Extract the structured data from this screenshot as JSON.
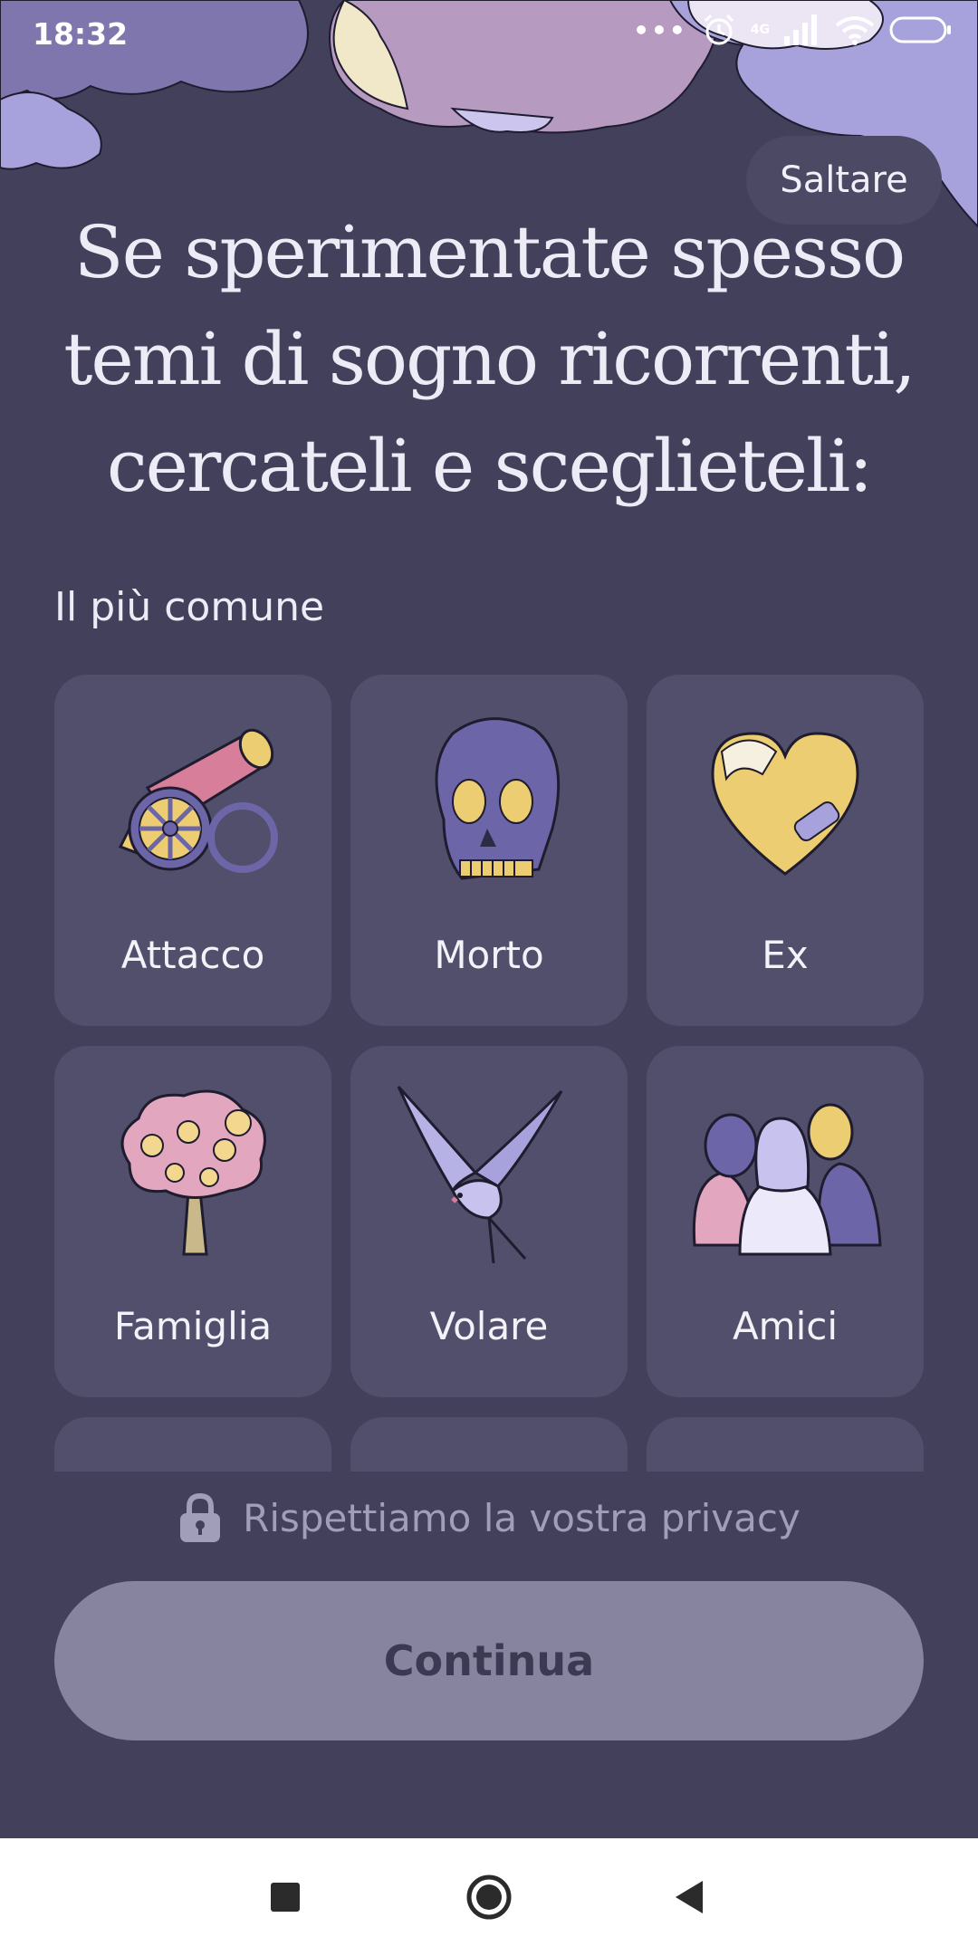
{
  "status_bar": {
    "time": "18:32",
    "network": "4G"
  },
  "header": {
    "skip_label": "Saltare"
  },
  "headline": "Se sperimentate spesso temi di sogno ricorrenti, cercateli e sceglieteli:",
  "section": {
    "label": "Il più comune"
  },
  "themes": [
    {
      "label": "Attacco",
      "icon": "cannon-icon"
    },
    {
      "label": "Morto",
      "icon": "skull-icon"
    },
    {
      "label": "Ex",
      "icon": "bandaged-heart-icon"
    },
    {
      "label": "Famiglia",
      "icon": "tree-icon"
    },
    {
      "label": "Volare",
      "icon": "swallow-bird-icon"
    },
    {
      "label": "Amici",
      "icon": "friends-group-icon"
    }
  ],
  "footer": {
    "privacy_text": "Rispettiamo la vostra privacy",
    "continue_label": "Continua"
  },
  "colors": {
    "background": "#42405a",
    "card": "#524f6c",
    "button_disabled": "#86849f",
    "cloud_purple": "#b79ac0",
    "cloud_lavender": "#a8a2dc",
    "accent_yellow": "#eccd72"
  }
}
